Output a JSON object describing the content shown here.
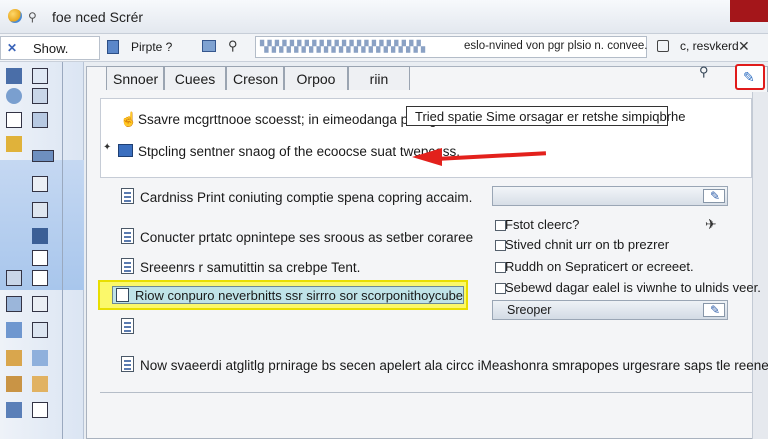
{
  "window": {
    "title": "foe nced Scrér"
  },
  "toolbar": {
    "show_label": "Show.",
    "item_a": "Pirpte ?",
    "address_text": "eslo-nvined von pgr plsio n. convee.",
    "item_d": "c, resvkerd"
  },
  "tabs": [
    "Snnoer",
    "Cuees",
    "Creson",
    "Orpoo",
    "riin"
  ],
  "upper": {
    "row1": "Ssavre mcgrttnooe scoesst; in eimeodanga pnilagns,..",
    "callout": "Tried spatie Sime orsagar er retshe simpiqbrhe",
    "row2": "Stpcling sentner snaog of the ecoocse suat twepcess."
  },
  "list": {
    "item1": "Cardniss Print coniuting comptie spena copring accaim.",
    "item2": "Conucter prtatc opnintepe ses sroous as setber coraree",
    "item3": "Sreeenrs r samutittin sa crebpe Tent.",
    "highlighted": "Riow conpuro neverbnitts ssr sirrro sor scorponithoycube",
    "item6": "Now svaeerdi atglitlg prnirage bs secen apelert ala circc iMeashonra smrapopes urgesrare saps tle reenee."
  },
  "options": {
    "cb1": "Fstot cleerc?",
    "cb2": "Stived chnit urr on tb prezrer",
    "cb3": "Ruddh on Sepraticert or ecreeet.",
    "cb4": "Sebewd dagar ealel is viwnhe to ulnids veer.",
    "combo2_value": "Sreoper"
  },
  "colors": {
    "highlight": "#fbf86a",
    "annotation_red": "#e3211c",
    "accent_blue": "#2f6fc2"
  }
}
